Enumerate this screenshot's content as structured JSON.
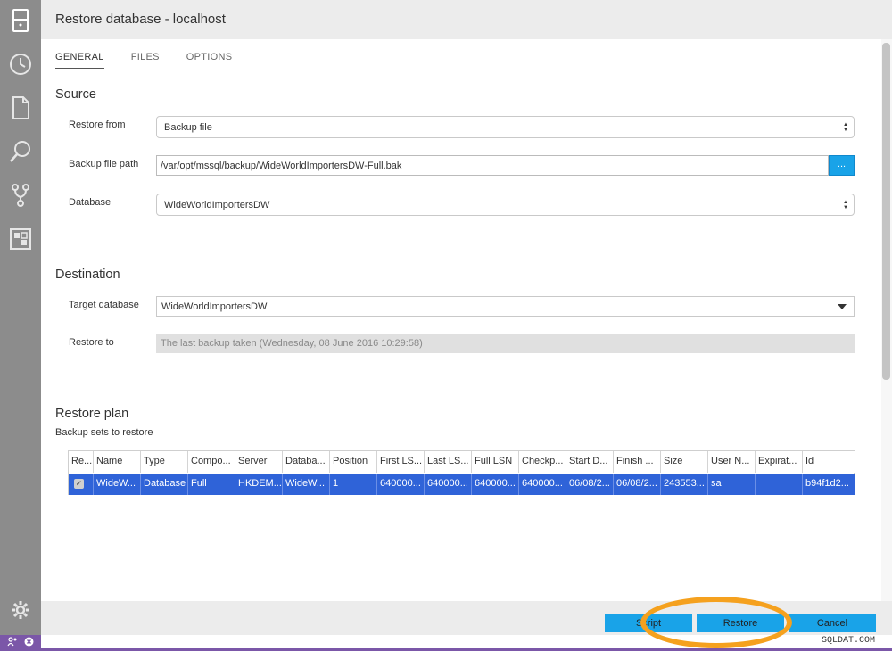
{
  "dialog": {
    "title": "Restore database - localhost"
  },
  "tabs": [
    {
      "label": "GENERAL"
    },
    {
      "label": "FILES"
    },
    {
      "label": "OPTIONS"
    }
  ],
  "source": {
    "title": "Source",
    "restore_from_label": "Restore from",
    "restore_from_value": "Backup file",
    "backup_path_label": "Backup file path",
    "backup_path_value": "/var/opt/mssql/backup/WideWorldImportersDW-Full.bak",
    "browse_label": "...",
    "database_label": "Database",
    "database_value": "WideWorldImportersDW"
  },
  "destination": {
    "title": "Destination",
    "target_label": "Target database",
    "target_value": "WideWorldImportersDW",
    "restore_to_label": "Restore to",
    "restore_to_value": "The last backup taken (Wednesday, 08 June 2016 10:29:58)"
  },
  "plan": {
    "title": "Restore plan",
    "subtitle": "Backup sets to restore",
    "columns": [
      "Re...",
      "Name",
      "Type",
      "Compo...",
      "Server",
      "Databa...",
      "Position",
      "First LS...",
      "Last LS...",
      "Full LSN",
      "Checkp...",
      "Start D...",
      "Finish ...",
      "Size",
      "User N...",
      "Expirat...",
      "Id"
    ],
    "row": {
      "checked": "✓",
      "cells": [
        "WideW...",
        "Database",
        "Full",
        "HKDEM...",
        "WideW...",
        "1",
        "640000...",
        "640000...",
        "640000...",
        "640000...",
        "06/08/2...",
        "06/08/2...",
        "243553...",
        "sa",
        "",
        "b94f1d2..."
      ]
    }
  },
  "footer": {
    "script_label": "Script",
    "restore_label": "Restore",
    "cancel_label": "Cancel"
  },
  "watermark": "SQLDAT.COM",
  "colors": {
    "accent": "#19a3e8",
    "selection": "#2f63d8",
    "highlight_ring": "#f5a11e",
    "activity_bar": "#8c8c8c",
    "status_purple": "#7b57a8"
  },
  "icons": {
    "activity": [
      "server-icon",
      "history-icon",
      "file-icon",
      "search-icon",
      "source-control-icon",
      "extensions-icon"
    ],
    "bottom": "gear-icon"
  }
}
